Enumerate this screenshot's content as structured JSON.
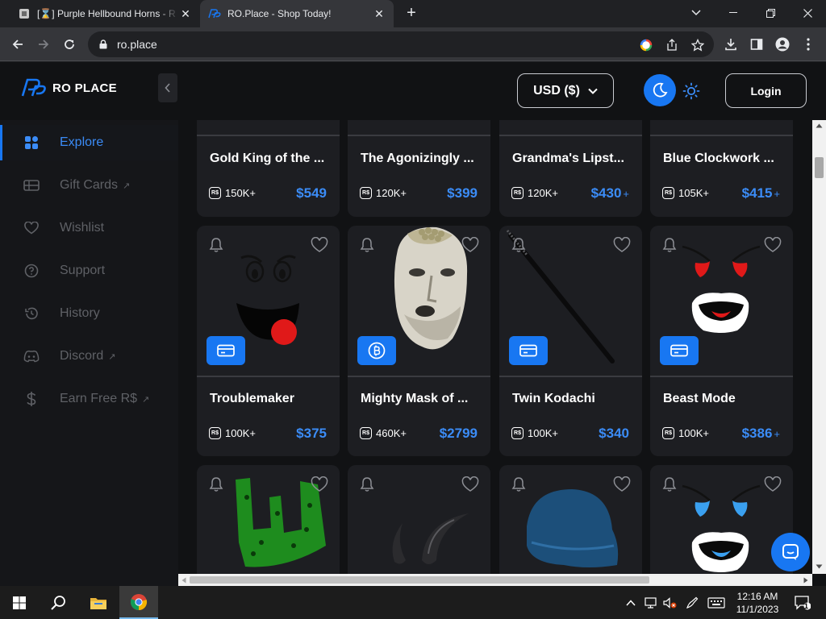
{
  "browser": {
    "tabs": [
      {
        "title": "[⌛] Purple Hellbound Horns - R",
        "active": false
      },
      {
        "title": "RO.Place - Shop Today!",
        "active": true
      }
    ],
    "url": "ro.place"
  },
  "header": {
    "logo_text": "RO PLACE",
    "currency": "USD ($)",
    "login_label": "Login"
  },
  "sidebar": {
    "items": [
      {
        "label": "Explore",
        "icon": "grid-icon",
        "external": false,
        "active": true
      },
      {
        "label": "Gift Cards",
        "icon": "gift-card-icon",
        "external": true,
        "active": false
      },
      {
        "label": "Wishlist",
        "icon": "heart-icon",
        "external": false,
        "active": false
      },
      {
        "label": "Support",
        "icon": "help-circle-icon",
        "external": false,
        "active": false
      },
      {
        "label": "History",
        "icon": "history-icon",
        "external": false,
        "active": false
      },
      {
        "label": "Discord",
        "icon": "discord-icon",
        "external": true,
        "active": false
      },
      {
        "label": "Earn Free R$",
        "icon": "dollar-icon",
        "external": true,
        "active": false
      }
    ],
    "external_glyph": "↗"
  },
  "products": {
    "rows": [
      [
        {
          "name": "Gold King of the ...",
          "stock": "150K",
          "price": "$549",
          "plus": false
        },
        {
          "name": "The Agonizingly ...",
          "stock": "120K",
          "price": "$399",
          "plus": false
        },
        {
          "name": "Grandma's Lipst...",
          "stock": "120K",
          "price": "$430",
          "plus": true
        },
        {
          "name": "Blue Clockwork ...",
          "stock": "105K",
          "price": "$415",
          "plus": true
        }
      ],
      [
        {
          "name": "Troublemaker",
          "stock": "100K",
          "price": "$375",
          "plus": false,
          "pay": "card"
        },
        {
          "name": "Mighty Mask of ...",
          "stock": "460K",
          "price": "$2799",
          "plus": false,
          "pay": "bitcoin"
        },
        {
          "name": "Twin Kodachi",
          "stock": "100K",
          "price": "$340",
          "plus": false,
          "pay": "card"
        },
        {
          "name": "Beast Mode",
          "stock": "100K",
          "price": "$386",
          "plus": true,
          "pay": "card"
        }
      ]
    ],
    "rs_badge": "R$",
    "stock_suffix": "+",
    "price_plus": "+"
  },
  "taskbar": {
    "time": "12:16 AM",
    "date": "11/1/2023",
    "notification_count": "1"
  },
  "colors": {
    "accent": "#1877f2",
    "price": "#3b8cf7",
    "card_bg": "#1d1e22",
    "page_bg": "#111214"
  }
}
